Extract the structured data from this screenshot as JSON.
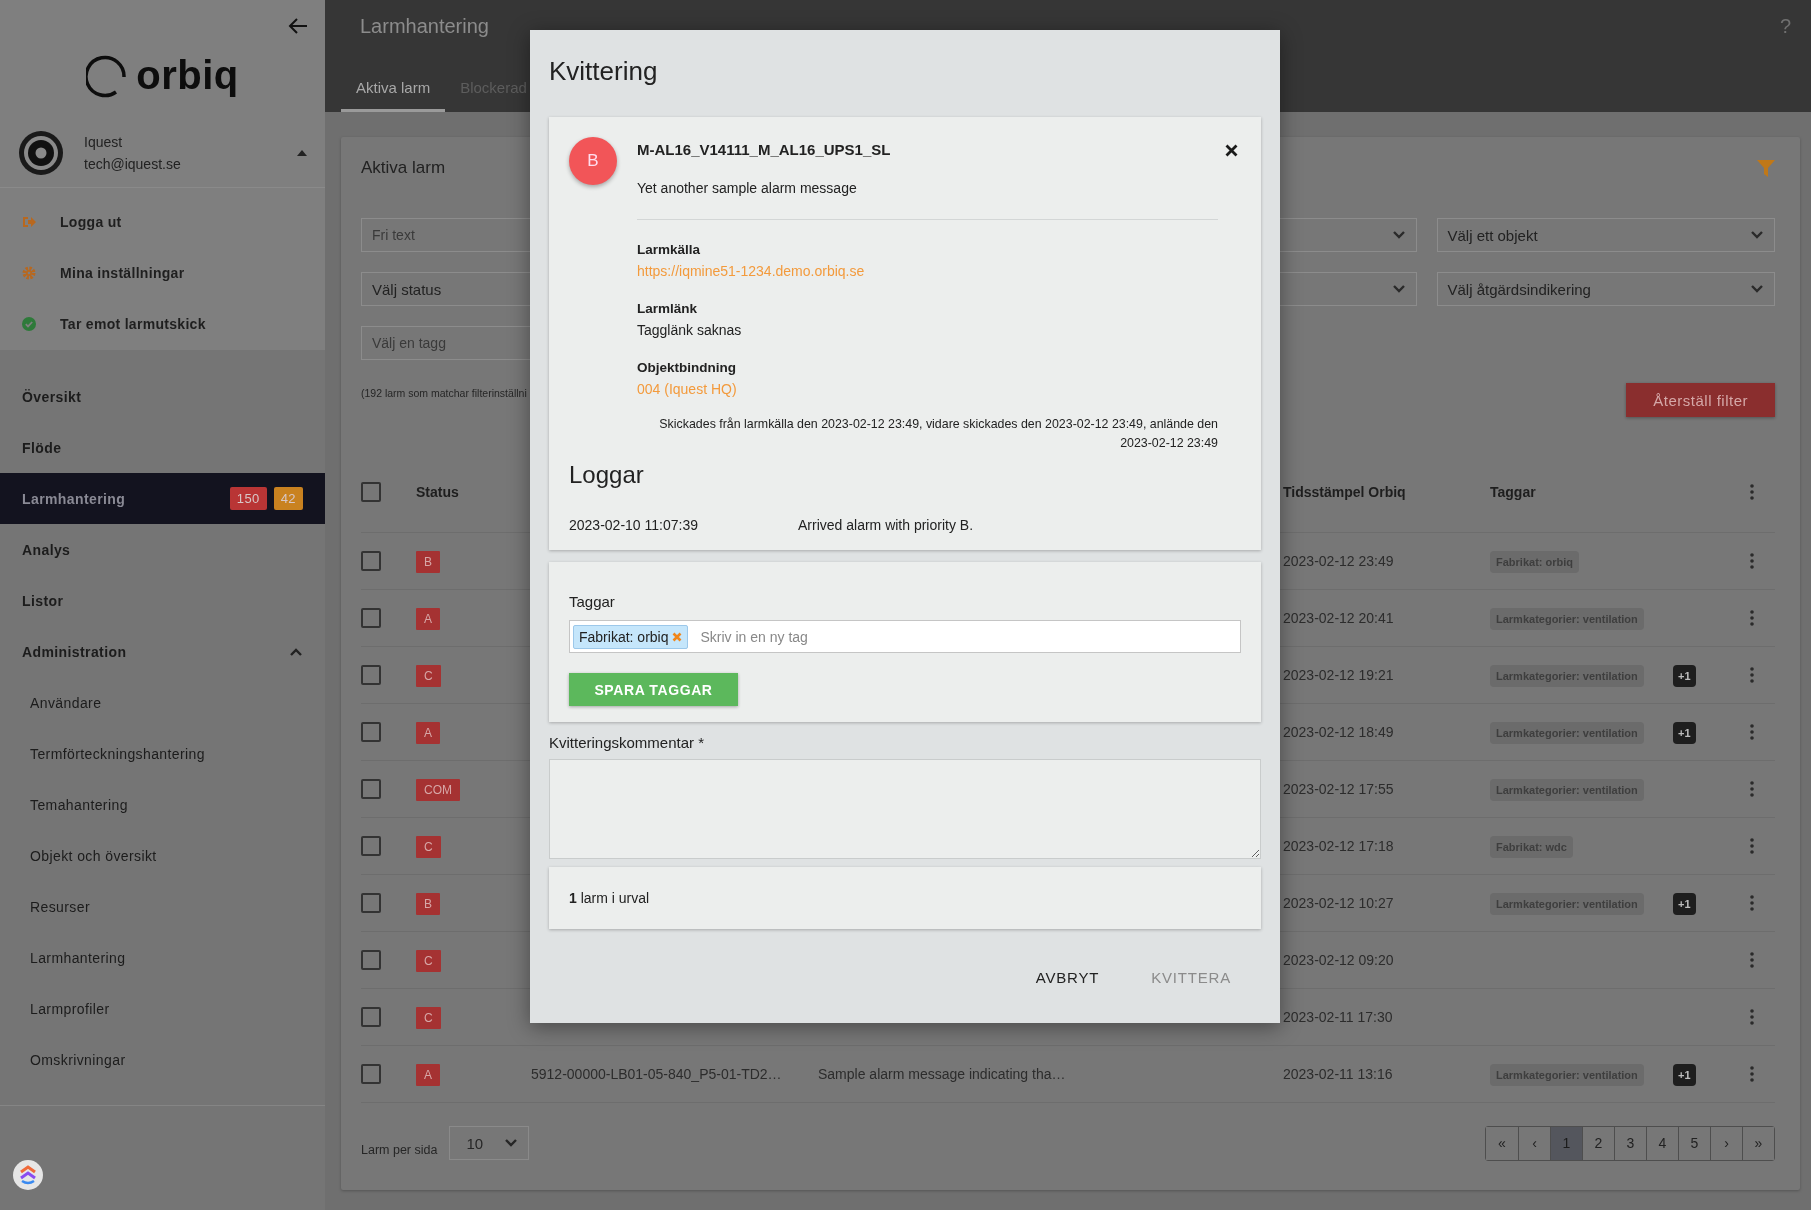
{
  "sidebar": {
    "logo": "orbiq",
    "user": {
      "name": "Iquest",
      "email": "tech@iquest.se",
      "expanded": true
    },
    "user_menu": [
      {
        "label": "Logga ut",
        "kind": "logout"
      },
      {
        "label": "Mina inställningar",
        "kind": "settings"
      },
      {
        "label": "Tar emot larmutskick",
        "kind": "status"
      }
    ],
    "nav": [
      {
        "label": "Översikt",
        "selected": false
      },
      {
        "label": "Flöde",
        "selected": false
      },
      {
        "label": "Larmhantering",
        "selected": true,
        "badges": [
          {
            "text": "150",
            "color": "#b93535"
          },
          {
            "text": "42",
            "color": "#c98220"
          }
        ]
      },
      {
        "label": "Analys",
        "selected": false
      },
      {
        "label": "Listor",
        "selected": false
      },
      {
        "label": "Administration",
        "selected": false,
        "expanded": true,
        "children": [
          {
            "label": "Användare",
            "selected": false
          },
          {
            "label": "Termförteckningshantering",
            "selected": false
          },
          {
            "label": "Temahantering",
            "selected": false
          },
          {
            "label": "Objekt och översikt",
            "selected": false
          },
          {
            "label": "Resurser",
            "selected": false
          },
          {
            "label": "Larmhantering",
            "selected": false
          },
          {
            "label": "Larmprofiler",
            "selected": false
          },
          {
            "label": "Omskrivningar",
            "selected": false
          }
        ]
      }
    ]
  },
  "header": {
    "title": "Larmhantering",
    "help": "?",
    "tabs": [
      {
        "label": "Aktiva larm",
        "selected": true
      },
      {
        "label": "Blockerad",
        "selected": false
      }
    ]
  },
  "alarms_card": {
    "title": "Aktiva larm",
    "filters": [
      [
        {
          "kind": "text",
          "placeholder": "Fri text"
        },
        {
          "kind": "empty"
        },
        {
          "kind": "select"
        },
        {
          "kind": "select",
          "value": "Välj ett objekt"
        }
      ],
      [
        {
          "kind": "value",
          "value": "Välj status"
        },
        {
          "kind": "empty"
        },
        {
          "kind": "select"
        },
        {
          "kind": "select",
          "value": "Välj åtgärdsindikering"
        }
      ],
      [
        {
          "kind": "text",
          "placeholder": "Välj en tagg"
        },
        {
          "kind": "empty"
        },
        {
          "kind": "empty"
        },
        {
          "kind": "empty"
        }
      ]
    ],
    "match_count": "(192 larm som matchar filterinställni",
    "reset_button": "Återställ filter",
    "table": {
      "select_all": {
        "checked": false
      },
      "columns": [
        "Status",
        "Tidsstämpel Orbiq",
        "Taggar"
      ],
      "rows": [
        {
          "checked": false,
          "status": "B",
          "time": "2023-02-12 23:49",
          "tag": "Fabrikat: orbiq"
        },
        {
          "checked": false,
          "status": "A",
          "time": "2023-02-12 20:41",
          "tag": "Larmkategorier: ventilation"
        },
        {
          "checked": false,
          "status": "C",
          "time": "2023-02-12 19:21",
          "tag": "Larmkategorier: ventilation",
          "more": "+1"
        },
        {
          "checked": false,
          "status": "A",
          "time": "2023-02-12 18:49",
          "tag": "Larmkategorier: ventilation",
          "more": "+1"
        },
        {
          "checked": false,
          "status": "COM",
          "time": "2023-02-12 17:55",
          "tag": "Larmkategorier: ventilation"
        },
        {
          "checked": false,
          "status": "C",
          "time": "2023-02-12 17:18",
          "tag": "Fabrikat: wdc"
        },
        {
          "checked": false,
          "status": "B",
          "time": "2023-02-12 10:27",
          "tag": "Larmkategorier: ventilation",
          "more": "+1"
        },
        {
          "checked": false,
          "status": "C",
          "time": "2023-02-12 09:20"
        },
        {
          "checked": false,
          "status": "C",
          "time": "2023-02-11 17:30"
        },
        {
          "checked": false,
          "status": "A",
          "id": "5912-00000-LB01-05-840_P5-01-TD2…",
          "message": "Sample alarm message indicating tha…",
          "time": "2023-02-11 13:16",
          "tag": "Larmkategorier: ventilation",
          "more": "+1"
        }
      ]
    },
    "per_page": {
      "label": "Larm per sida",
      "value": "10"
    },
    "pagination": [
      {
        "label": "«",
        "selected": false
      },
      {
        "label": "‹",
        "selected": false
      },
      {
        "label": "1",
        "selected": true
      },
      {
        "label": "2",
        "selected": false
      },
      {
        "label": "3",
        "selected": false
      },
      {
        "label": "4",
        "selected": false
      },
      {
        "label": "5",
        "selected": false
      },
      {
        "label": "›",
        "selected": false
      },
      {
        "label": "»",
        "selected": false
      }
    ]
  },
  "modal": {
    "title": "Kvittering",
    "alarm": {
      "priority": "B",
      "name": "M-AL16_V14111_M_AL16_UPS1_SL",
      "message": "Yet another sample alarm message",
      "fields": [
        {
          "label": "Larmkälla",
          "value": "https://iqmine51-1234.demo.orbiq.se",
          "kind": "link"
        },
        {
          "label": "Larmlänk",
          "value": "Tagglänk saknas",
          "kind": "text"
        },
        {
          "label": "Objektbindning",
          "value": "004 (Iquest HQ)",
          "kind": "link"
        }
      ],
      "sent": "Skickades från larmkälla den 2023-02-12 23:49, vidare skickades den 2023-02-12 23:49, anlände den 2023-02-12 23:49",
      "logs_title": "Loggar",
      "logs": [
        {
          "time": "2023-02-10 11:07:39",
          "text": "Arrived alarm with priority B."
        }
      ]
    },
    "tags": {
      "label": "Taggar",
      "chips": [
        {
          "text": "Fabrikat: orbiq"
        }
      ],
      "placeholder": "Skriv in en ny tag",
      "save": "SPARA TAGGAR"
    },
    "comment": {
      "label": "Kvitteringskommentar *"
    },
    "selection": "**1** larm i urval",
    "actions": [
      {
        "label": "AVBRYT",
        "disabled": false
      },
      {
        "label": "KVITTERA",
        "disabled": true
      }
    ]
  }
}
